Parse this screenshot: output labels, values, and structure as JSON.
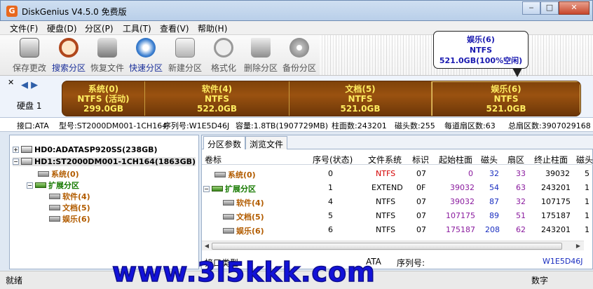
{
  "window": {
    "title": "DiskGenius V4.5.0 免费版",
    "app_icon": "G",
    "minimize": "‒",
    "maximize": "□",
    "close": "✕"
  },
  "menu": [
    "文件(F)",
    "硬盘(D)",
    "分区(P)",
    "工具(T)",
    "查看(V)",
    "帮助(H)"
  ],
  "toolbar": {
    "buttons": [
      {
        "label": "保存更改",
        "icon": "save-icon"
      },
      {
        "label": "搜索分区",
        "icon": "magnifier-icon"
      },
      {
        "label": "恢复文件",
        "icon": "restore-icon"
      },
      {
        "label": "快速分区",
        "icon": "quick-partition-icon"
      },
      {
        "label": "新建分区",
        "icon": "new-partition-icon"
      },
      {
        "label": "格式化",
        "icon": "format-icon"
      },
      {
        "label": "删除分区",
        "icon": "trash-icon"
      },
      {
        "label": "备份分区",
        "icon": "disc-icon"
      }
    ]
  },
  "tooltip": {
    "line1": "娱乐(6)",
    "line2": "NTFS",
    "line3": "521.0GB(100%空闲)"
  },
  "disk_map": {
    "label": "硬盘 1",
    "partitions": [
      {
        "name": "系统(0)",
        "fs": "NTFS (活动)",
        "size": "299.0GB"
      },
      {
        "name": "软件(4)",
        "fs": "NTFS",
        "size": "522.0GB"
      },
      {
        "name": "文档(5)",
        "fs": "NTFS",
        "size": "521.0GB"
      },
      {
        "name": "娱乐(6)",
        "fs": "NTFS",
        "size": "521.0GB"
      }
    ]
  },
  "disk_info": {
    "interface": "接口:ATA",
    "model": "型号:ST2000DM001-1CH164",
    "serial": "序列号:W1E5D46J",
    "capacity": "容量:1.8TB(1907729MB)",
    "cylinders": "柱面数:243201",
    "heads": "磁头数:255",
    "sectors_per_track": "每道扇区数:63",
    "total_sectors": "总扇区数:3907029168"
  },
  "tree": {
    "disks": [
      {
        "label": "HD0:ADATASP920SS(238GB)",
        "expander": "+"
      },
      {
        "label": "HD1:ST2000DM001-1CH164(1863GB)",
        "expander": "−"
      }
    ],
    "partitions": [
      {
        "label": "系统(0)"
      },
      {
        "label": "扩展分区",
        "expander": "−"
      },
      {
        "label": "软件(4)"
      },
      {
        "label": "文档(5)"
      },
      {
        "label": "娱乐(6)"
      }
    ]
  },
  "tabs": [
    "分区参数",
    "浏览文件"
  ],
  "grid": {
    "headers": [
      "卷标",
      "序号(状态)",
      "文件系统",
      "标识",
      "起始柱面",
      "磁头",
      "扇区",
      "终止柱面",
      "磁头"
    ],
    "rows": [
      {
        "label": "系统(0)",
        "index": "0",
        "fs": "NTFS",
        "id": "07",
        "start_cyl": "0",
        "head": "32",
        "sector": "33",
        "end_cyl": "39032",
        "end_head": "5"
      },
      {
        "label": "扩展分区",
        "index": "1",
        "fs": "EXTEND",
        "id": "0F",
        "start_cyl": "39032",
        "head": "54",
        "sector": "63",
        "end_cyl": "243201",
        "end_head": "1",
        "expander": "−"
      },
      {
        "label": "软件(4)",
        "index": "4",
        "fs": "NTFS",
        "id": "07",
        "start_cyl": "39032",
        "head": "87",
        "sector": "32",
        "end_cyl": "107175",
        "end_head": "1"
      },
      {
        "label": "文档(5)",
        "index": "5",
        "fs": "NTFS",
        "id": "07",
        "start_cyl": "107175",
        "head": "89",
        "sector": "51",
        "end_cyl": "175187",
        "end_head": "1"
      },
      {
        "label": "娱乐(6)",
        "index": "6",
        "fs": "NTFS",
        "id": "07",
        "start_cyl": "175187",
        "head": "208",
        "sector": "62",
        "end_cyl": "243201",
        "end_head": "1"
      }
    ]
  },
  "details": {
    "interface_label": "接口类型:",
    "interface_value": "ATA",
    "serial_label": "序列号:",
    "serial_value": "W1E5D46J"
  },
  "status": {
    "left": "就绪",
    "right": "数字"
  },
  "watermark": "www.3l5kkk.com"
}
